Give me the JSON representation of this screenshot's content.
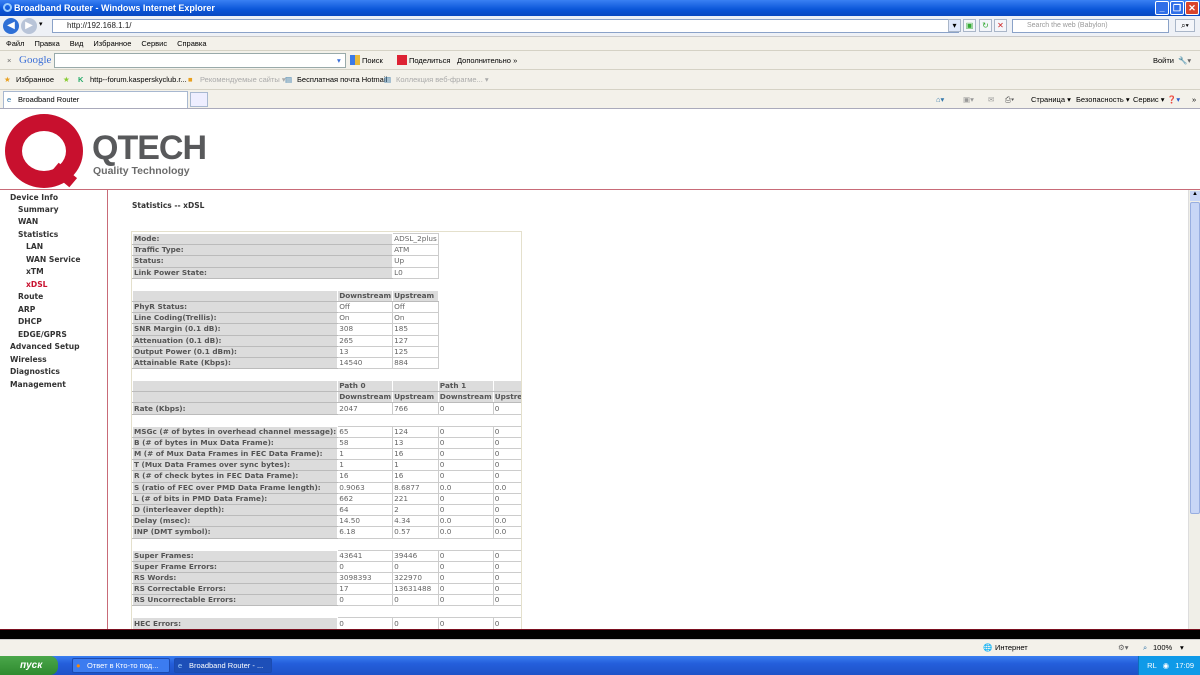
{
  "browser": {
    "window_title": "Broadband Router - Windows Internet Explorer",
    "address": "http://192.168.1.1/",
    "search_placeholder": "Search the web (Babylon)",
    "menu": [
      "Файл",
      "Правка",
      "Вид",
      "Избранное",
      "Сервис",
      "Справка"
    ],
    "google_bar": {
      "logo": "Google",
      "search": "Поиск",
      "share": "Поделиться",
      "more": "Дополнительно »",
      "login": "Войти"
    },
    "favorites": {
      "label": "Избранное",
      "items": [
        "http--forum.kasperskyclub.r...",
        "Рекомендуемые сайты ▾",
        "Бесплатная почта Hotmail",
        "Коллекция веб-фрагме... ▾"
      ]
    },
    "tab_title": "Broadband Router",
    "command_bar": [
      "Страница ▾",
      "Безопасность ▾",
      "Сервис ▾"
    ],
    "status_zone": "Интернет",
    "zoom": "100%"
  },
  "logo": {
    "brand": "QTECH",
    "tagline": "Quality Technology"
  },
  "sidebar": {
    "active_color": "#c8102e",
    "items": [
      {
        "label": "Device Info",
        "level": 0
      },
      {
        "label": "Summary",
        "level": 1
      },
      {
        "label": "WAN",
        "level": 1
      },
      {
        "label": "Statistics",
        "level": 1
      },
      {
        "label": "LAN",
        "level": 2
      },
      {
        "label": "WAN Service",
        "level": 2
      },
      {
        "label": "xTM",
        "level": 2
      },
      {
        "label": "xDSL",
        "level": 2,
        "active": true
      },
      {
        "label": "Route",
        "level": 1
      },
      {
        "label": "ARP",
        "level": 1
      },
      {
        "label": "DHCP",
        "level": 1
      },
      {
        "label": "EDGE/GPRS",
        "level": 1
      },
      {
        "label": "Advanced Setup",
        "level": 0
      },
      {
        "label": "Wireless",
        "level": 0
      },
      {
        "label": "Diagnostics",
        "level": 0
      },
      {
        "label": "Management",
        "level": 0
      }
    ]
  },
  "page_title": "Statistics -- xDSL",
  "stats": [
    {
      "type": "kv",
      "label": "Mode:",
      "value": "ADSL_2plus"
    },
    {
      "type": "kv",
      "label": "Traffic Type:",
      "value": "ATM"
    },
    {
      "type": "kv",
      "label": "Status:",
      "value": "Up"
    },
    {
      "type": "kv",
      "label": "Link Power State:",
      "value": "L0"
    },
    {
      "type": "blank"
    },
    {
      "type": "hdr2",
      "cells": [
        "Downstream",
        "Upstream"
      ]
    },
    {
      "type": "row2",
      "label": "PhyR Status:",
      "values": [
        "Off",
        "Off"
      ]
    },
    {
      "type": "row2",
      "label": "Line Coding(Trellis):",
      "values": [
        "On",
        "On"
      ]
    },
    {
      "type": "row2",
      "label": "SNR Margin (0.1 dB):",
      "values": [
        "308",
        "185"
      ]
    },
    {
      "type": "row2",
      "label": "Attenuation (0.1 dB):",
      "values": [
        "265",
        "127"
      ]
    },
    {
      "type": "row2",
      "label": "Output Power (0.1 dBm):",
      "values": [
        "13",
        "125"
      ]
    },
    {
      "type": "row2",
      "label": "Attainable Rate (Kbps):",
      "values": [
        "14540",
        "884"
      ]
    },
    {
      "type": "blank"
    },
    {
      "type": "hdr4",
      "cells": [
        "Path 0",
        "",
        "Path 1",
        ""
      ]
    },
    {
      "type": "hdr4",
      "cells": [
        "Downstream",
        "Upstream",
        "Downstream",
        "Upstream"
      ]
    },
    {
      "type": "row4",
      "label": "Rate (Kbps):",
      "values": [
        "2047",
        "766",
        "0",
        "0"
      ]
    },
    {
      "type": "blank"
    },
    {
      "type": "row4",
      "label": "MSGc (# of bytes in overhead channel message):",
      "values": [
        "65",
        "124",
        "0",
        "0"
      ]
    },
    {
      "type": "row4",
      "label": "B (# of bytes in Mux Data Frame):",
      "values": [
        "58",
        "13",
        "0",
        "0"
      ]
    },
    {
      "type": "row4",
      "label": "M (# of Mux Data Frames in FEC Data Frame):",
      "values": [
        "1",
        "16",
        "0",
        "0"
      ]
    },
    {
      "type": "row4",
      "label": "T (Mux Data Frames over sync bytes):",
      "values": [
        "1",
        "1",
        "0",
        "0"
      ]
    },
    {
      "type": "row4",
      "label": "R (# of check bytes in FEC Data Frame):",
      "values": [
        "16",
        "16",
        "0",
        "0"
      ]
    },
    {
      "type": "row4",
      "label": "S (ratio of FEC over PMD Data Frame length):",
      "values": [
        "0.9063",
        "8.6877",
        "0.0",
        "0.0"
      ]
    },
    {
      "type": "row4",
      "label": "L (# of bits in PMD Data Frame):",
      "values": [
        "662",
        "221",
        "0",
        "0"
      ]
    },
    {
      "type": "row4",
      "label": "D (interleaver depth):",
      "values": [
        "64",
        "2",
        "0",
        "0"
      ]
    },
    {
      "type": "row4",
      "label": "Delay (msec):",
      "values": [
        "14.50",
        "4.34",
        "0.0",
        "0.0"
      ]
    },
    {
      "type": "row4",
      "label": "INP (DMT symbol):",
      "values": [
        "6.18",
        "0.57",
        "0.0",
        "0.0"
      ]
    },
    {
      "type": "blank"
    },
    {
      "type": "row4",
      "label": "Super Frames:",
      "values": [
        "43641",
        "39446",
        "0",
        "0"
      ]
    },
    {
      "type": "row4",
      "label": "Super Frame Errors:",
      "values": [
        "0",
        "0",
        "0",
        "0"
      ]
    },
    {
      "type": "row4",
      "label": "RS Words:",
      "values": [
        "3098393",
        "322970",
        "0",
        "0"
      ]
    },
    {
      "type": "row4",
      "label": "RS Correctable Errors:",
      "values": [
        "17",
        "13631488",
        "0",
        "0"
      ]
    },
    {
      "type": "row4",
      "label": "RS Uncorrectable Errors:",
      "values": [
        "0",
        "0",
        "0",
        "0"
      ]
    },
    {
      "type": "blank"
    },
    {
      "type": "row4",
      "label": "HEC Errors:",
      "values": [
        "0",
        "0",
        "0",
        "0"
      ]
    }
  ],
  "taskbar": {
    "start": "пуск",
    "tasks": [
      "Ответ в Кто-то под...",
      "Broadband Router - ..."
    ],
    "lang": "RL",
    "clock": "17:09"
  }
}
